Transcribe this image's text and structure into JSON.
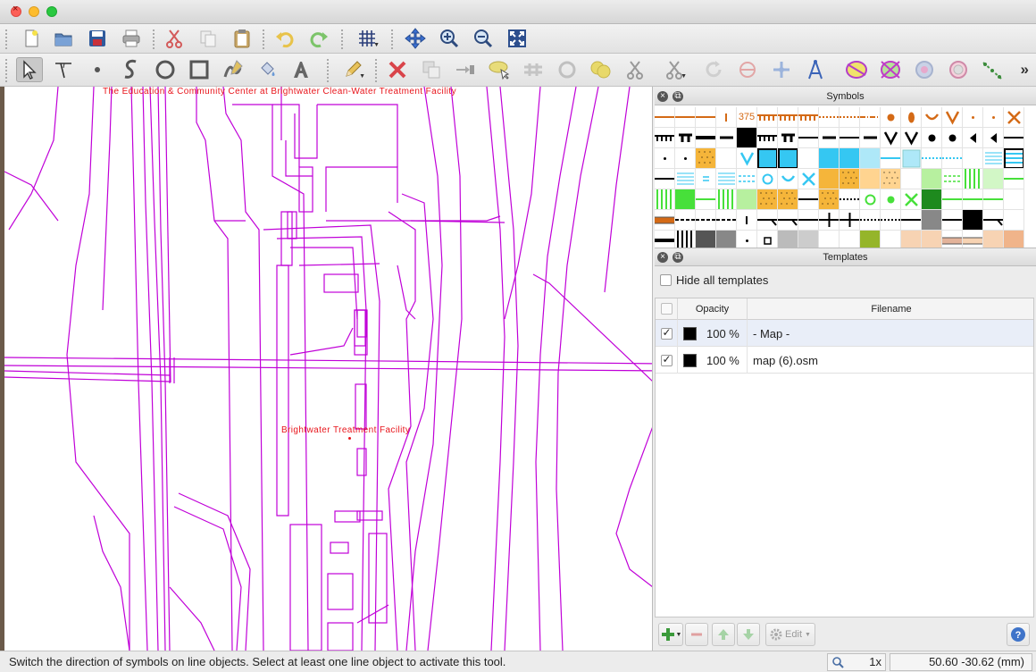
{
  "toolbar": {
    "top_icons": [
      "new-file-icon",
      "open-folder-icon",
      "save-icon",
      "print-icon",
      "cut-icon",
      "copy-icon",
      "paste-icon",
      "undo-icon",
      "redo-icon",
      "grid-icon",
      "pan-icon",
      "zoom-in-icon",
      "zoom-out-icon",
      "fullscreen-icon"
    ],
    "edit_icons": [
      "edit-objects-icon",
      "edit-lines-icon",
      "draw-point-icon",
      "draw-path-icon",
      "draw-circle-icon",
      "draw-rectangle-icon",
      "draw-freehand-icon",
      "fill-icon",
      "draw-text-icon",
      "pencil-icon",
      "delete-icon",
      "duplicate-icon",
      "switch-symbol-icon",
      "switch-dash-icon",
      "connect-icon",
      "cutout-icon",
      "union-icon",
      "cut-object-icon",
      "cut-hole-icon",
      "rotate-icon",
      "scale-icon",
      "rotate-pattern-icon",
      "measure-icon",
      "unify-areas-icon",
      "intersect-areas-icon",
      "difference-icon",
      "xor-icon",
      "distribute-points-icon"
    ],
    "more_label": "»"
  },
  "map": {
    "labels": [
      "The Education & Community Center at Brightwater Clean-Water Treatment Facility",
      "Brightwater Treatment Facility"
    ],
    "line_color": "#c000d8",
    "label_color": "#e8151b"
  },
  "symbols_panel": {
    "title": "Symbols",
    "number_symbol": "375"
  },
  "templates_panel": {
    "title": "Templates",
    "hide_all_label": "Hide all templates",
    "columns": {
      "opacity": "Opacity",
      "filename": "Filename"
    },
    "rows": [
      {
        "checked": true,
        "opacity": "100 %",
        "filename": "- Map -"
      },
      {
        "checked": true,
        "opacity": "100 %",
        "filename": "map (6).osm"
      }
    ],
    "edit_label": "Edit"
  },
  "status": {
    "message": "Switch the direction of symbols on line objects. Select at least one line object to activate this tool.",
    "zoom": "1x",
    "coords": "50.60 -30.62 (mm)"
  }
}
